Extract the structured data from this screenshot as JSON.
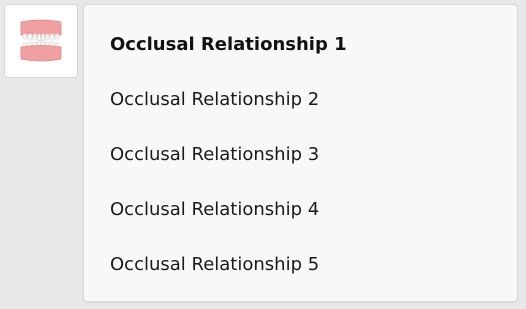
{
  "icon_tile": {
    "icon": "dentures-icon",
    "colors": {
      "gum": "#f0a0a0",
      "gum_dark": "#e08585",
      "teeth": "#f5f5f5"
    }
  },
  "menu": {
    "selected_index": 0,
    "items": [
      {
        "label": "Occlusal Relationship 1"
      },
      {
        "label": "Occlusal Relationship 2"
      },
      {
        "label": "Occlusal Relationship 3"
      },
      {
        "label": "Occlusal Relationship 4"
      },
      {
        "label": "Occlusal Relationship 5"
      }
    ]
  }
}
